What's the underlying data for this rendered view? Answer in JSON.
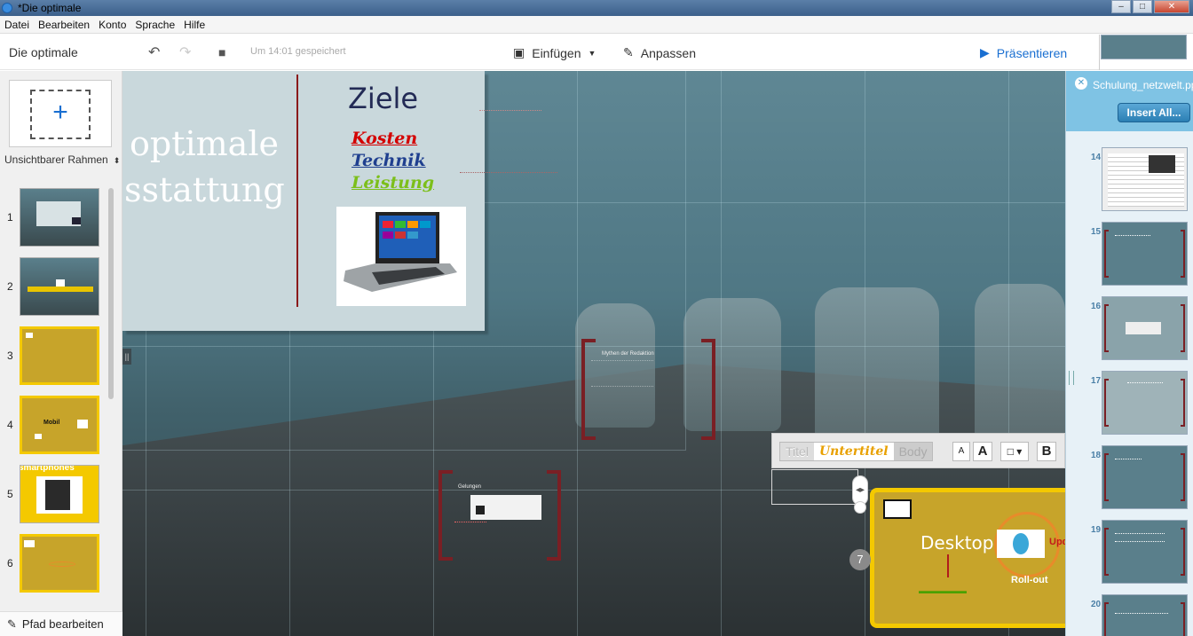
{
  "window": {
    "title": "*Die optimale"
  },
  "menu": [
    "Datei",
    "Bearbeiten",
    "Konto",
    "Sprache",
    "Hilfe"
  ],
  "toolbar": {
    "doc_title": "Die optimale",
    "saved_status": "Um 14:01 gespeichert",
    "insert_label": "Einfügen",
    "customize_label": "Anpassen",
    "present_label": "Präsentieren"
  },
  "sidebar": {
    "frame_type": "Unsichtbarer Rahmen",
    "edit_path_label": "Pfad bearbeiten",
    "slides": [
      {
        "num": "1"
      },
      {
        "num": "2"
      },
      {
        "num": "3"
      },
      {
        "num": "4",
        "label": "Mobil"
      },
      {
        "num": "5",
        "label": "smartphones"
      },
      {
        "num": "6"
      }
    ]
  },
  "canvas": {
    "title_line1": "optimale",
    "title_line2": "sstattung",
    "ziele": "Ziele",
    "keywords": [
      {
        "text": "Kosten",
        "color": "#d40000"
      },
      {
        "text": "Technik",
        "color": "#1f3f8f"
      },
      {
        "text": "Leistung",
        "color": "#7cbf1a"
      }
    ],
    "myth_title": "Mythen der Redaktion",
    "gelungen": "Gelungen",
    "desktops": "Desktops",
    "rollout": "Roll-out",
    "upd": "Upd",
    "path_number": "7"
  },
  "text_toolbar": {
    "style_title": "Titel",
    "style_subtitle": "Untertitel",
    "style_body": "Body",
    "font_smaller": "A",
    "font_larger": "A",
    "bold": "B"
  },
  "import_panel": {
    "filename": "Schulung_netzwelt.ppt",
    "insert_all": "Insert All...",
    "slides": [
      {
        "num": "14"
      },
      {
        "num": "15"
      },
      {
        "num": "16"
      },
      {
        "num": "17"
      },
      {
        "num": "18"
      },
      {
        "num": "19"
      },
      {
        "num": "20"
      }
    ]
  },
  "colors": {
    "accent": "#1a6fd1",
    "frame_yellow": "#f4c900",
    "bracket": "#7a1f24"
  }
}
